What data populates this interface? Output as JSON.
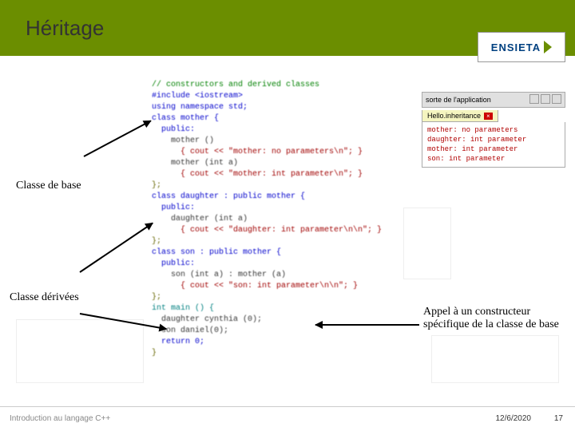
{
  "slide": {
    "title": "Héritage",
    "logo_text": "ENSIETA"
  },
  "annotations": {
    "base_class": "Classe de base",
    "derived_classes": "Classe dérivées",
    "constructor_call": "Appel à un constructeur spécifique de la classe de base"
  },
  "code": {
    "l01": "// constructors and derived classes",
    "l02": "#include <iostream>",
    "l03": "using namespace std;",
    "l04": "",
    "l05": "class mother {",
    "l06": "  public:",
    "l07": "    mother ()",
    "l08": "      { cout << \"mother: no parameters\\n\"; }",
    "l09": "    mother (int a)",
    "l10": "      { cout << \"mother: int parameter\\n\"; }",
    "l11": "};",
    "l12": "",
    "l13": "class daughter : public mother {",
    "l14": "  public:",
    "l15": "    daughter (int a)",
    "l16": "      { cout << \"daughter: int parameter\\n\\n\"; }",
    "l17": "};",
    "l18": "",
    "l19": "class son : public mother {",
    "l20": "  public:",
    "l21": "    son (int a) : mother (a)",
    "l22": "      { cout << \"son: int parameter\\n\\n\"; }",
    "l23": "};",
    "l24": "",
    "l25": "int main () {",
    "l26": "  daughter cynthia (0);",
    "l27": "  son daniel(0);",
    "l28": "",
    "l29": "  return 0;",
    "l30": "}"
  },
  "terminal": {
    "window_title": "sorte de l'application",
    "tab_label": "Hello.inheritance",
    "lines": {
      "o1": "mother: no parameters",
      "o2": "daughter: int parameter",
      "o3": "",
      "o4": "mother: int parameter",
      "o5": "son: int parameter"
    }
  },
  "footer": {
    "subtitle": "Introduction au langage C++",
    "date": "12/6/2020",
    "page": "17"
  }
}
